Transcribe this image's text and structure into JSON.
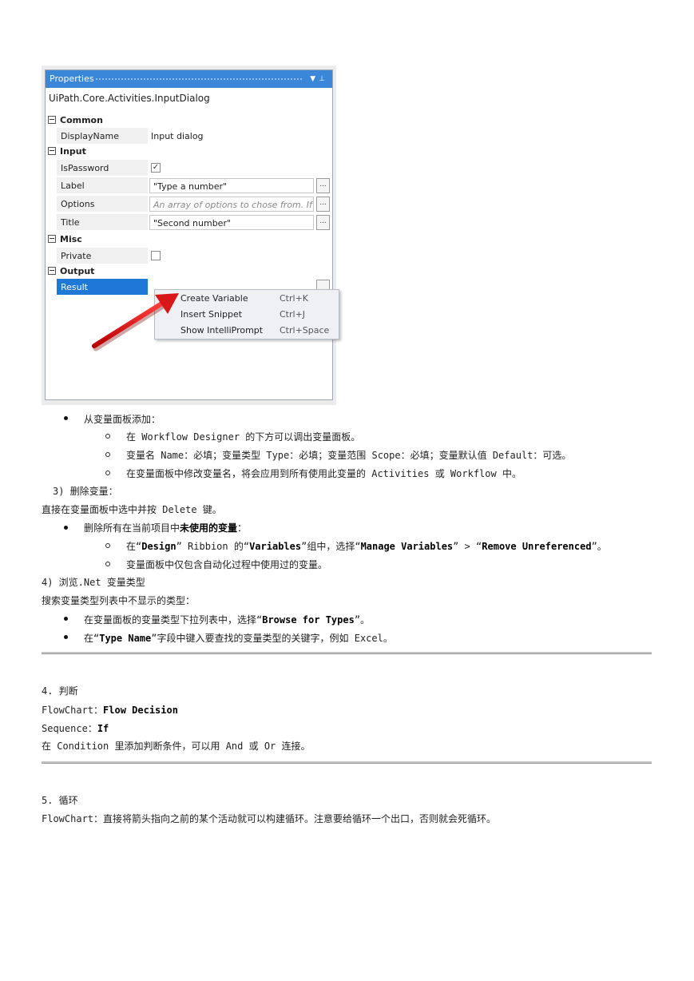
{
  "panel": {
    "title": "Properties",
    "type_name": "UiPath.Core.Activities.InputDialog",
    "categories": {
      "common": "Common",
      "input": "Input",
      "misc": "Misc",
      "output": "Output"
    },
    "props": {
      "display_name": {
        "label": "DisplayName",
        "value": "Input dialog"
      },
      "is_password": {
        "label": "IsPassword",
        "checked": true
      },
      "label": {
        "label": "Label",
        "value": "\"Type a number\""
      },
      "options": {
        "label": "Options",
        "placeholder": "An array of options to chose from. If set to"
      },
      "title": {
        "label": "Title",
        "value": "\"Second number\""
      },
      "private": {
        "label": "Private",
        "checked": false
      },
      "result": {
        "label": "Result",
        "value": ""
      }
    },
    "ellipsis": "...",
    "context_menu": [
      {
        "label": "Create Variable",
        "shortcut": "Ctrl+K"
      },
      {
        "label": "Insert Snippet",
        "shortcut": "Ctrl+J"
      },
      {
        "label": "Show IntelliPrompt",
        "shortcut": "Ctrl+Space"
      }
    ]
  },
  "doc": {
    "b1": "从变量面板添加：",
    "b1_sub1": "在 Workflow Designer 的下方可以调出变量面板。",
    "b1_sub2": "变量名 Name：必填；变量类型 Type：必填；变量范围 Scope：必填；变量默认值 Default：可选。",
    "b1_sub3": "在变量面板中修改变量名，将会应用到所有使用此变量的 Activities 或 Workflow 中。",
    "h_delete": "3) 删除变量：",
    "p_delete": "直接在变量面板中选中并按 Delete 键。",
    "b2_pre": "删除所有在当前项目中",
    "b2_bold": "未使用的变量",
    "b2_post": "：",
    "b2_sub1": {
      "t1": "在“",
      "design": "Design",
      "t2": "” Ribbion 的“",
      "variables": "Variables",
      "t3": "”组中，选择“",
      "manage": "Manage Variables",
      "t4": "” > “",
      "remove": "Remove Unreferenced",
      "t5": "”。"
    },
    "b2_sub2": "变量面板中仅包含自动化过程中使用过的变量。",
    "h_browse": "4) 浏览.Net 变量类型",
    "p_browse": "搜索变量类型列表中不显示的类型：",
    "b3": {
      "t1": "在变量面板的变量类型下拉列表中，选择“",
      "bold": "Browse for Types",
      "t2": "”。"
    },
    "b4": {
      "t1": "在“",
      "bold": "Type Name",
      "t2": "”字段中键入要查找的变量类型的关键字，例如 Excel。"
    },
    "h_decision": "4. 判断",
    "flowchart_label": "FlowChart：",
    "flowchart_value": "Flow Decision",
    "sequence_label": "Sequence：",
    "sequence_value": "If",
    "p_condition": "在 Condition 里添加判断条件，可以用 And 或 Or 连接。",
    "h_loop": "5. 循环",
    "p_loop": "FlowChart：直接将箭头指向之前的某个活动就可以构建循环。注意要给循环一个出口，否则就会死循环。"
  }
}
